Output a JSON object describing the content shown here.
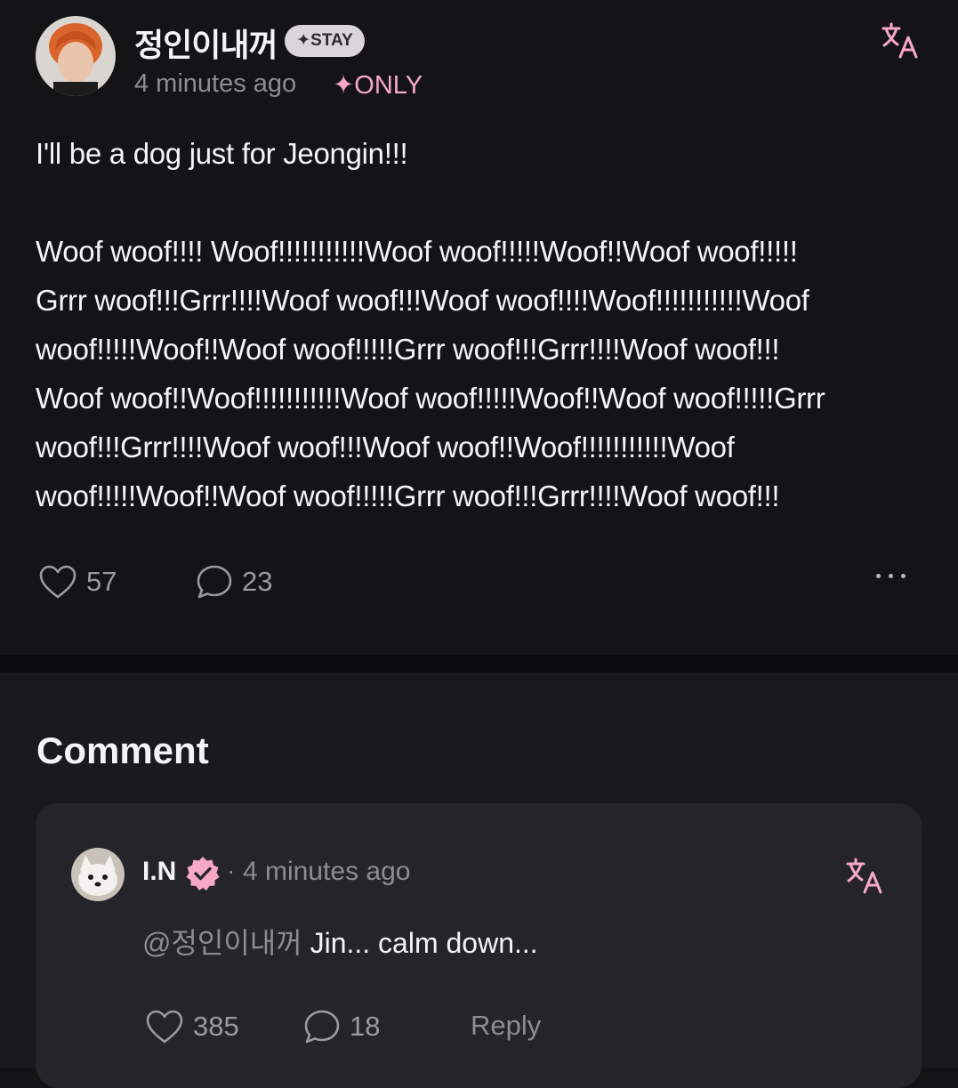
{
  "post": {
    "username": "정인이내꺼",
    "membership_badge": "✦STAY",
    "timestamp": "4 minutes ago",
    "visibility_badge": "✦ONLY",
    "text_line1": "I'll be a dog just for Jeongin!!!",
    "text_body": "Woof woof!!!! Woof!!!!!!!!!!!Woof woof!!!!!Woof!!Woof woof!!!!!\nGrrr woof!!!Grrr!!!!Woof woof!!!Woof woof!!!!Woof!!!!!!!!!!!Woof\nwoof!!!!!Woof!!Woof woof!!!!!Grrr woof!!!Grrr!!!!Woof woof!!!\nWoof woof!!Woof!!!!!!!!!!!Woof woof!!!!!Woof!!Woof woof!!!!!Grrr\nwoof!!!Grrr!!!!Woof woof!!!Woof woof!!Woof!!!!!!!!!!!Woof\nwoof!!!!!Woof!!Woof woof!!!!!Grrr woof!!!Grrr!!!!Woof woof!!!",
    "likes": "57",
    "comments": "23",
    "icons": {
      "translate": "translate-icon",
      "like": "heart-icon",
      "comment": "speech-bubble-icon",
      "more": "more-dots-icon"
    }
  },
  "comment_section": {
    "heading": "Comment",
    "comments": [
      {
        "author": "I.N",
        "separator": "·",
        "timestamp": "4 minutes ago",
        "mention": "@정인이내꺼",
        "text": " Jin... calm down...",
        "likes": "385",
        "replies": "18",
        "reply_label": "Reply"
      }
    ]
  },
  "colors": {
    "background": "#141417",
    "accent_pink": "#f7a8c4",
    "muted_text": "#8c8c93",
    "card": "#24242a"
  }
}
